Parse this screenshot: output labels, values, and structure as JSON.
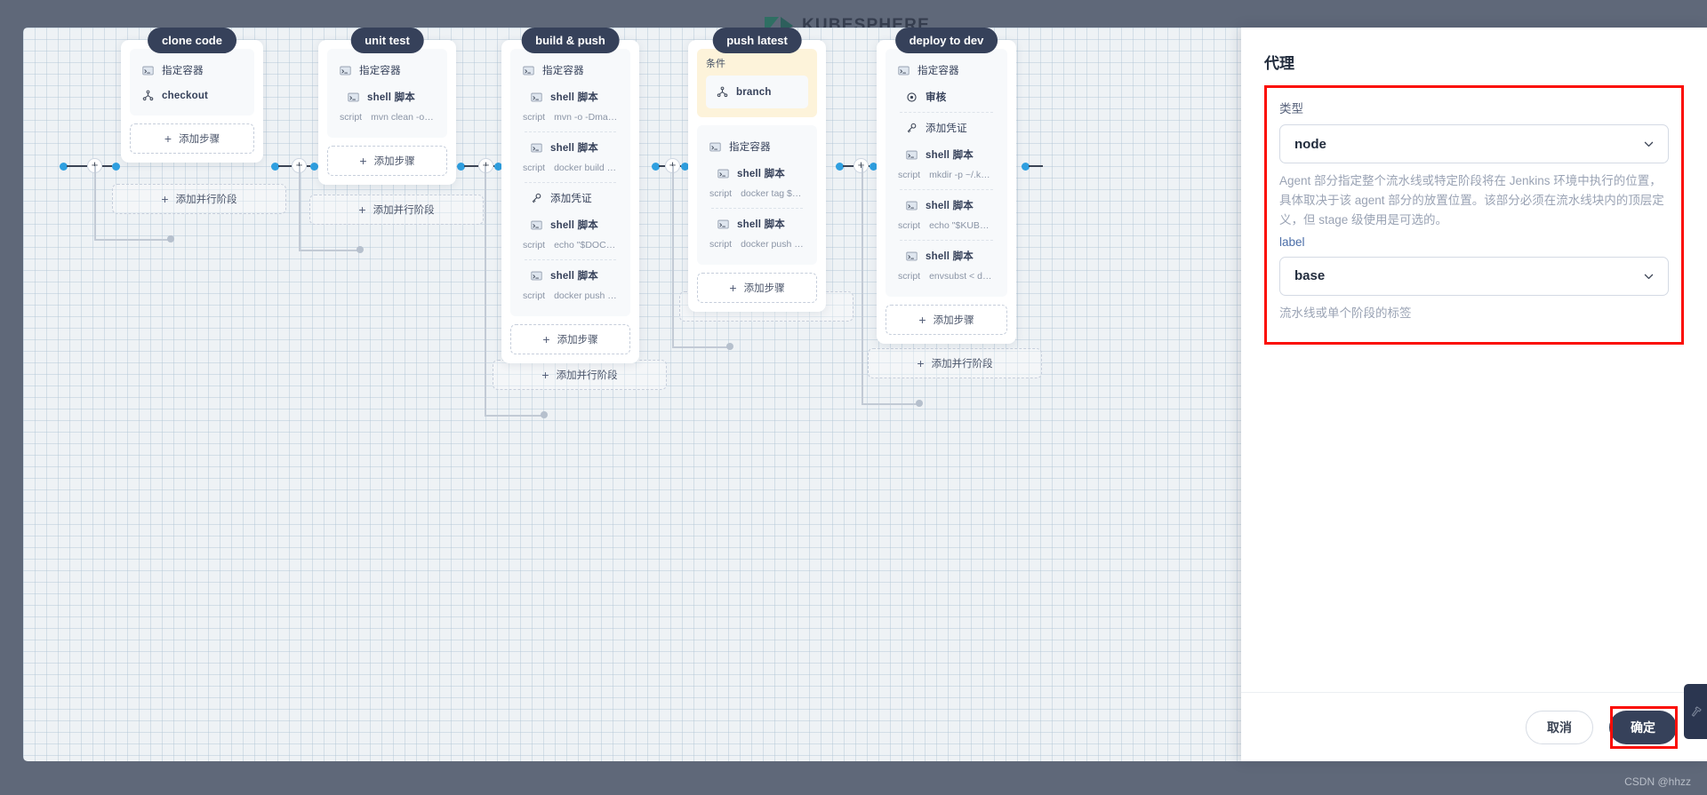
{
  "app": {
    "logo_text": "KUBESPHERE",
    "watermark": "CSDN @hhzz"
  },
  "canvas": {
    "zoom_in_label": "+",
    "zoom_out_label": "−",
    "add_step_label": "添加步骤",
    "add_parallel_label": "添加并行阶段",
    "script_key": "script"
  },
  "stages": [
    {
      "name": "clone code",
      "condition": null,
      "steps": [
        {
          "icon": "terminal-icon",
          "label": "指定容器",
          "bold": false,
          "indent": false,
          "script": null,
          "divider_after": false
        },
        {
          "icon": "branch-icon",
          "label": "checkout",
          "bold": true,
          "indent": false,
          "script": null,
          "divider_after": false
        }
      ]
    },
    {
      "name": "unit test",
      "condition": null,
      "steps": [
        {
          "icon": "terminal-icon",
          "label": "指定容器",
          "bold": false,
          "indent": false,
          "script": null,
          "divider_after": false
        },
        {
          "icon": "terminal-icon",
          "label": "shell 脚本",
          "bold": true,
          "indent": true,
          "script": "mvn clean -o -gs `pwd`/con…",
          "divider_after": false
        }
      ]
    },
    {
      "name": "build & push",
      "condition": null,
      "steps": [
        {
          "icon": "terminal-icon",
          "label": "指定容器",
          "bold": false,
          "indent": false,
          "script": null,
          "divider_after": false
        },
        {
          "icon": "terminal-icon",
          "label": "shell 脚本",
          "bold": true,
          "indent": true,
          "script": "mvn -o -Dmaven.test.skip=t…",
          "divider_after": true
        },
        {
          "icon": "terminal-icon",
          "label": "shell 脚本",
          "bold": true,
          "indent": true,
          "script": "docker build -f Dockerfile-o…",
          "divider_after": true
        },
        {
          "icon": "key-icon",
          "label": "添加凭证",
          "bold": false,
          "indent": true,
          "script": null,
          "divider_after": false
        },
        {
          "icon": "terminal-icon",
          "label": "shell 脚本",
          "bold": true,
          "indent": true,
          "script": "echo \"$DOCKER_PASS…",
          "divider_after": true
        },
        {
          "icon": "terminal-icon",
          "label": "shell 脚本",
          "bold": true,
          "indent": true,
          "script": "docker push $REGISTR…",
          "divider_after": false
        }
      ]
    },
    {
      "name": "push latest",
      "condition": {
        "label": "条件",
        "icon": "branch-icon",
        "value": "branch"
      },
      "steps": [
        {
          "icon": "terminal-icon",
          "label": "指定容器",
          "bold": false,
          "indent": false,
          "script": null,
          "divider_after": false
        },
        {
          "icon": "terminal-icon",
          "label": "shell 脚本",
          "bold": true,
          "indent": true,
          "script": "docker tag $REGISTRY/$D…",
          "divider_after": true
        },
        {
          "icon": "terminal-icon",
          "label": "shell 脚本",
          "bold": true,
          "indent": true,
          "script": "docker push $REGISTRY/$…",
          "divider_after": false
        }
      ]
    },
    {
      "name": "deploy to dev",
      "condition": null,
      "steps": [
        {
          "icon": "terminal-icon",
          "label": "指定容器",
          "bold": false,
          "indent": false,
          "script": null,
          "divider_after": false
        },
        {
          "icon": "gear-icon",
          "label": "审核",
          "bold": true,
          "indent": true,
          "script": null,
          "divider_after": true
        },
        {
          "icon": "key-icon",
          "label": "添加凭证",
          "bold": false,
          "indent": true,
          "script": null,
          "divider_after": false
        },
        {
          "icon": "terminal-icon",
          "label": "shell 脚本",
          "bold": true,
          "indent": true,
          "script": "mkdir -p ~/.kube/",
          "divider_after": true
        },
        {
          "icon": "terminal-icon",
          "label": "shell 脚本",
          "bold": true,
          "indent": true,
          "script": "echo \"$KUBECONFIG_…",
          "divider_after": true
        },
        {
          "icon": "terminal-icon",
          "label": "shell 脚本",
          "bold": true,
          "indent": true,
          "script": "envsubst < deploy/dev-o…",
          "divider_after": false
        }
      ]
    }
  ],
  "drawer": {
    "title": "代理",
    "type_label": "类型",
    "type_value": "node",
    "type_hint": "Agent 部分指定整个流水线或特定阶段将在 Jenkins 环境中执行的位置， 具体取决于该 agent 部分的放置位置。该部分必须在流水线块内的顶层定义，但 stage 级使用是可选的。",
    "label_label": "label",
    "label_value": "base",
    "label_hint": "流水线或单个阶段的标签",
    "cancel_label": "取消",
    "confirm_label": "确定",
    "highlight_color": "#fb0d05"
  }
}
